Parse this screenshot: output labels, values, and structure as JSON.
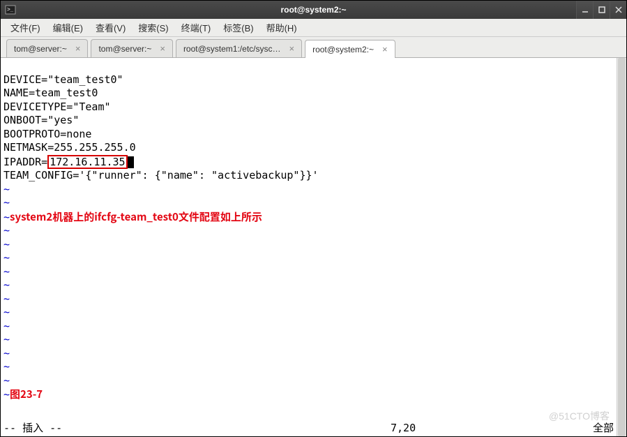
{
  "window": {
    "title": "root@system2:~"
  },
  "menu": {
    "items": [
      "文件(F)",
      "编辑(E)",
      "查看(V)",
      "搜索(S)",
      "终端(T)",
      "标签(B)",
      "帮助(H)"
    ]
  },
  "tabs": [
    {
      "label": "tom@server:~",
      "active": false
    },
    {
      "label": "tom@server:~",
      "active": false
    },
    {
      "label": "root@system1:/etc/sysc…",
      "active": false
    },
    {
      "label": "root@system2:~",
      "active": true
    }
  ],
  "file": {
    "line1": "DEVICE=\"team_test0\"",
    "line2": "NAME=team_test0",
    "line3": "DEVICETYPE=\"Team\"",
    "line4": "ONBOOT=\"yes\"",
    "line5": "BOOTPROTO=none",
    "line6": "NETMASK=255.255.255.0",
    "ip_label": "IPADDR=",
    "ip_value": "172.16.11.35",
    "line8": "TEAM_CONFIG='{\"runner\": {\"name\": \"activebackup\"}}'"
  },
  "annotation": "system2机器上的ifcfg-team_test0文件配置如上所示",
  "figure_label": "图23-7",
  "tilde_char": "~",
  "status": {
    "mode": "-- 插入 --",
    "position": "7,20",
    "percent": "全部"
  },
  "watermark": "@51CTO博客"
}
